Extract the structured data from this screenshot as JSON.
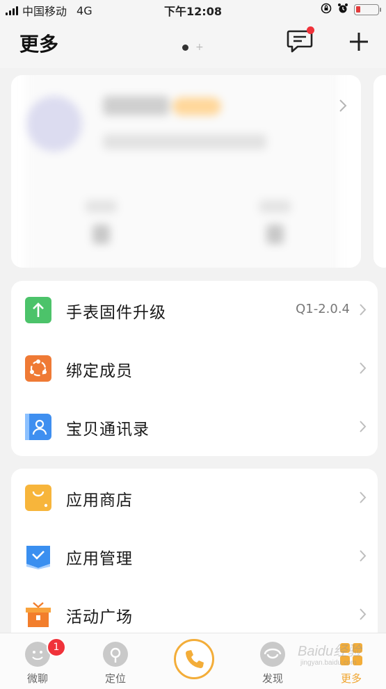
{
  "status_bar": {
    "carrier": "中国移动",
    "network": "4G",
    "time": "下午12:08",
    "battery_color": "#e23b3b"
  },
  "header": {
    "title": "更多",
    "message_icon": "message-icon",
    "add_icon": "plus-icon",
    "notification_dot_color": "#f0323a"
  },
  "profile_card": {
    "avatar_icon": "avatar-icon",
    "chevron_icon": "chevron-right-icon"
  },
  "device_menu": [
    {
      "label": "手表固件升级",
      "value": "Q1-2.0.4",
      "icon": "upload-icon",
      "color": "#4cc36a"
    },
    {
      "label": "绑定成员",
      "value": "",
      "icon": "members-icon",
      "color": "#ef7a35"
    },
    {
      "label": "宝贝通讯录",
      "value": "",
      "icon": "contacts-icon",
      "color": "#3f8ff0"
    }
  ],
  "app_menu": [
    {
      "label": "应用商店",
      "icon": "shopping-bag-icon",
      "color": "#f7b53b"
    },
    {
      "label": "应用管理",
      "icon": "app-manage-icon",
      "color": "#3a8ff0"
    },
    {
      "label": "活动广场",
      "icon": "gift-icon",
      "color": "#f27e2c"
    }
  ],
  "tab_bar": {
    "tabs": [
      {
        "label": "微聊",
        "icon": "chat-face-icon",
        "badge": "1"
      },
      {
        "label": "定位",
        "icon": "location-icon"
      },
      {
        "label": "",
        "icon": "phone-call-icon"
      },
      {
        "label": "发现",
        "icon": "discover-icon"
      },
      {
        "label": "更多",
        "icon": "grid-more-icon"
      }
    ],
    "active_color": "#f0a52e",
    "call_color": "#f3ad39"
  },
  "watermark": {
    "text": "Baidu经验",
    "sub": "jingyan.baidu.com"
  }
}
